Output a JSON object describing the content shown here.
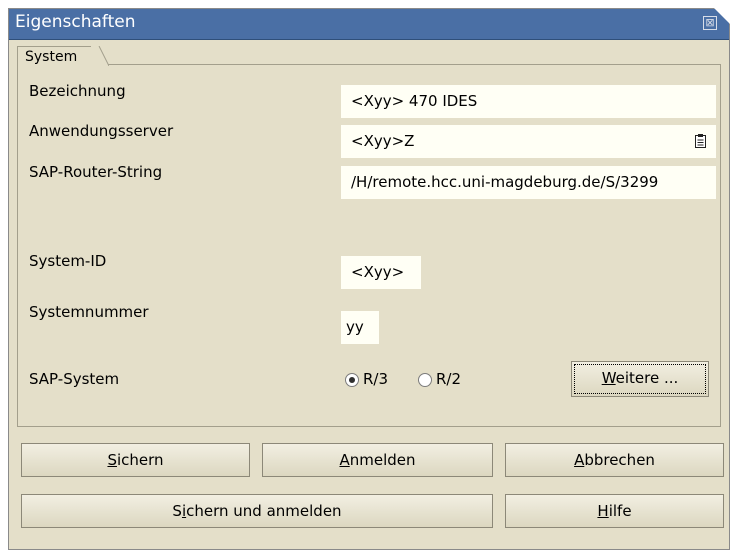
{
  "window": {
    "title": "Eigenschaften",
    "close_glyph": "⊠"
  },
  "tab": {
    "label": "System"
  },
  "fields": {
    "bezeichnung": {
      "label": "Bezeichnung",
      "value": "<Xyy> 470 IDES"
    },
    "anwendungsserver": {
      "label": "Anwendungsserver",
      "value": "<Xyy>Z",
      "icon": "dropdown-list-icon"
    },
    "router": {
      "label": "SAP-Router-String",
      "value": "/H/remote.hcc.uni-magdeburg.de/S/3299"
    },
    "system_id": {
      "label": "System-ID",
      "value": "<Xyy>"
    },
    "systemnummer": {
      "label": "Systemnummer",
      "value": "yy"
    }
  },
  "sap_system": {
    "label": "SAP-System",
    "options": [
      {
        "label": "R/3",
        "checked": true
      },
      {
        "label": "R/2",
        "checked": false
      }
    ],
    "more_button": {
      "prefix": "",
      "mnemonic": "W",
      "rest": "eitere ..."
    }
  },
  "buttons": {
    "sichern": {
      "prefix": "",
      "mnemonic": "S",
      "rest": "ichern"
    },
    "anmelden": {
      "prefix": "",
      "mnemonic": "A",
      "rest": "nmelden"
    },
    "abbrechen": {
      "prefix": "",
      "mnemonic": "A",
      "rest": "bbrechen"
    },
    "sichern_anmelden": {
      "prefix": "S",
      "mnemonic": "i",
      "rest": "chern und anmelden"
    },
    "hilfe": {
      "prefix": "",
      "mnemonic": "H",
      "rest": "ilfe"
    }
  },
  "colors": {
    "titlebar": "#4a6fa5",
    "dialog_bg": "#e4dfc9",
    "field_bg": "#fffff5"
  }
}
